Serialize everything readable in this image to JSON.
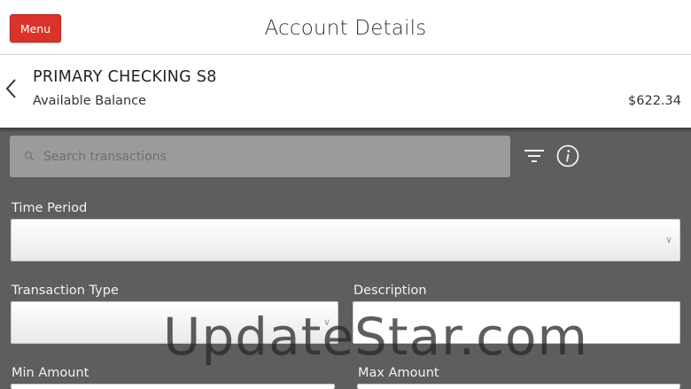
{
  "header": {
    "menu_label": "Menu",
    "title": "Account Details"
  },
  "account": {
    "name": "PRIMARY CHECKING S8",
    "balance_label": "Available Balance",
    "balance_value": "$622.34"
  },
  "search": {
    "placeholder": "Search transactions"
  },
  "filters": {
    "time_period_label": "Time Period",
    "transaction_type_label": "Transaction Type",
    "description_label": "Description",
    "min_amount_label": "Min Amount",
    "max_amount_label": "Max Amount"
  },
  "watermark": "UpdateStar.com",
  "colors": {
    "accent": "#d9332b",
    "background": "#5e5e5e"
  }
}
